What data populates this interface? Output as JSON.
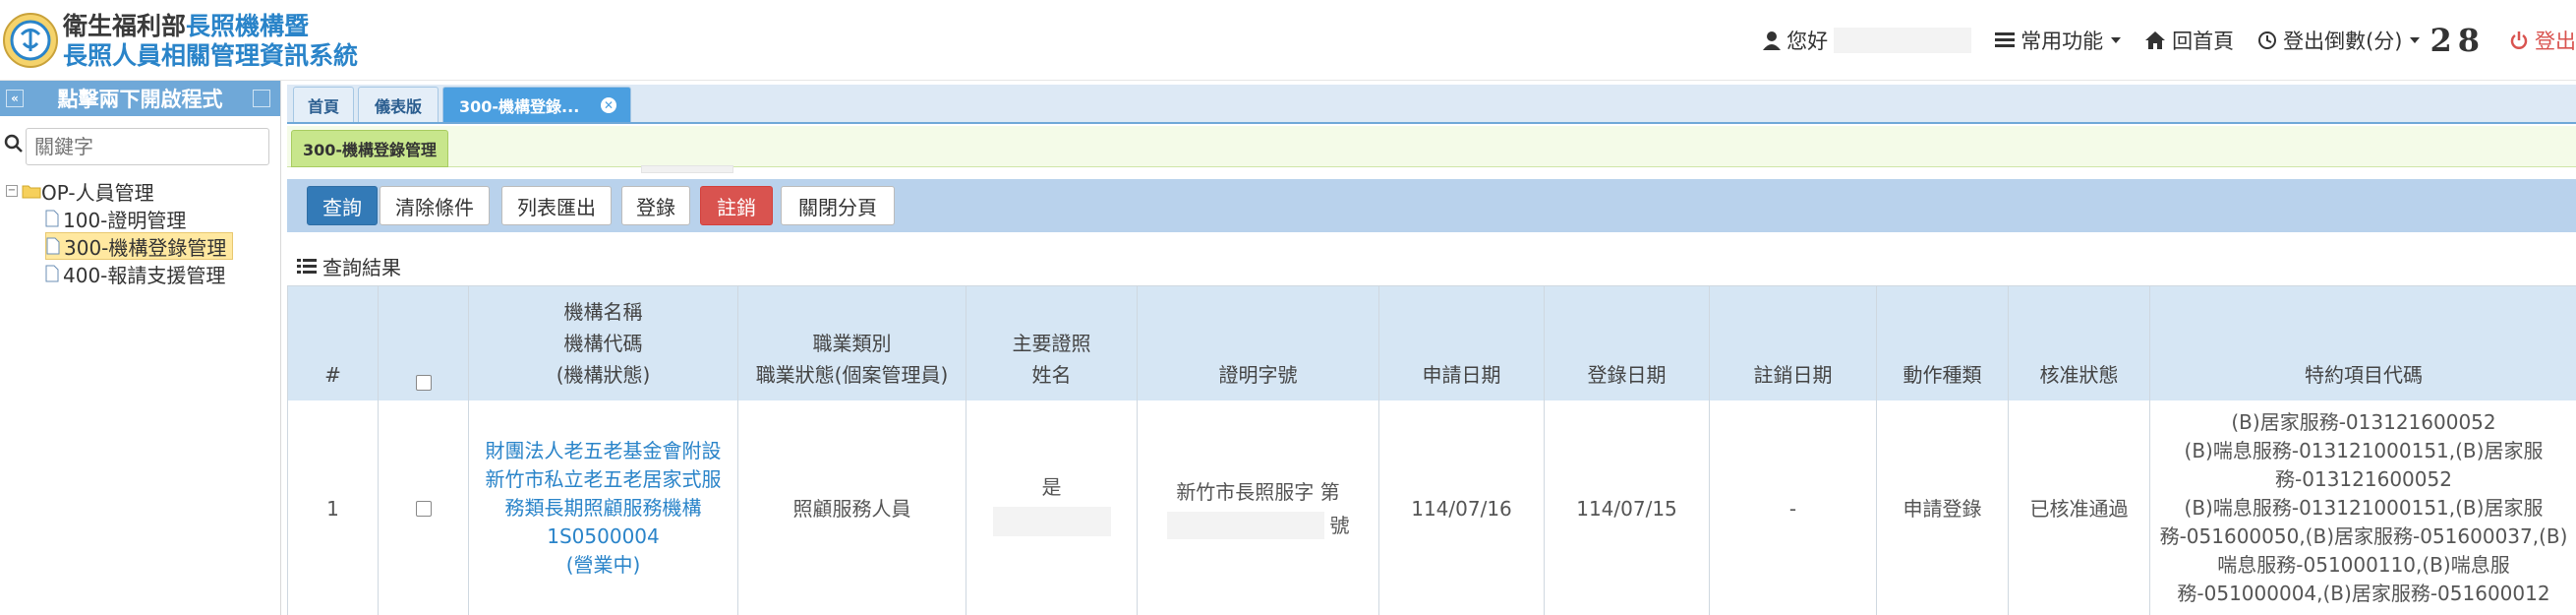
{
  "header": {
    "title_line1_dark": "衛生福利部",
    "title_line1_blue": "長照機構暨",
    "title_line2": "長照人員相關管理資訊系統",
    "nav": {
      "hello": "您好",
      "common": "常用功能",
      "home": "回首頁",
      "logout_countdown": "登出倒數(分)",
      "countdown_value": "28",
      "logout": "登出"
    }
  },
  "sidebar": {
    "title": "點擊兩下開啟程式",
    "search_placeholder": "關鍵字",
    "tree": {
      "root": "OP-人員管理",
      "children": [
        "100-證明管理",
        "300-機構登錄管理",
        "400-報請支援管理"
      ]
    }
  },
  "tabs": [
    "首頁",
    "儀表版",
    "300-機構登錄..."
  ],
  "subtab": "300-機構登錄管理",
  "toolbar": {
    "query": "查詢",
    "clear": "清除條件",
    "export": "列表匯出",
    "register": "登錄",
    "cancel": "註銷",
    "close": "關閉分頁"
  },
  "result_title": "查詢結果",
  "table": {
    "headers": {
      "index": "#",
      "org_line1": "機構名稱",
      "org_line2": "機構代碼",
      "org_line3": "(機構狀態)",
      "cat_line1": "職業類別",
      "cat_line2": "職業狀態(個案管理員)",
      "cert_line1": "主要證照",
      "cert_line2": "姓名",
      "cert_no": "證明字號",
      "apply_date": "申請日期",
      "reg_date": "登錄日期",
      "cancel_date": "註銷日期",
      "action": "動作種類",
      "approval": "核准狀態",
      "special": "特約項目代碼"
    },
    "row": {
      "index": "1",
      "org_name": "財團法人老五老基金會附設新竹市私立老五老居家式服務類長期照顧服務機構",
      "org_code": "1S0500004",
      "org_status": "(營業中)",
      "category": "照顧服務人員",
      "main_cert": "是",
      "cert_prefix": "新竹市長照服字 第",
      "cert_suffix": "號",
      "apply_date": "114/07/16",
      "reg_date": "114/07/15",
      "cancel_date": "-",
      "action": "申請登錄",
      "approval": "已核准通過",
      "special": "(B)居家服務-013121600052\n(B)喘息服務-013121000151,(B)居家服務-013121600052\n(B)喘息服務-013121000151,(B)居家服務-051600050,(B)居家服務-051600037,(B)喘息服務-051000110,(B)喘息服務-051000004,(B)居家服務-051600012"
    }
  }
}
